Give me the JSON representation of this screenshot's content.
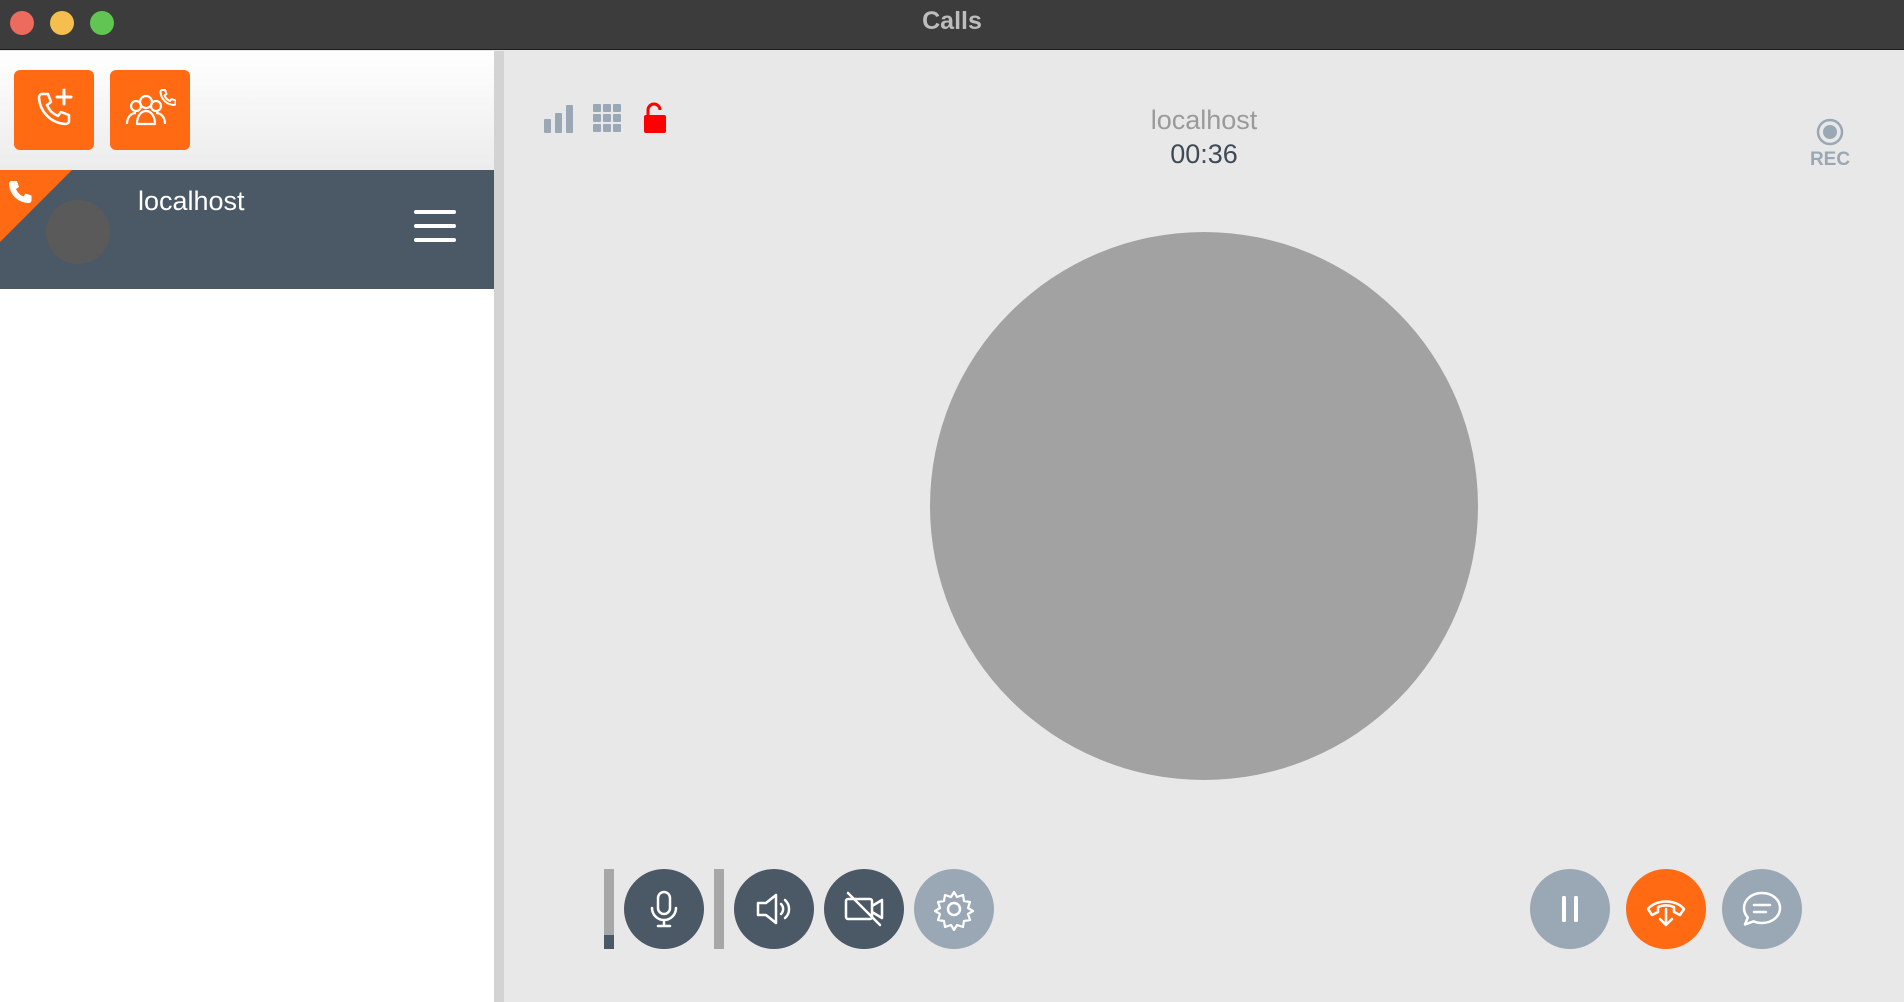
{
  "window": {
    "title": "Calls"
  },
  "sidebar": {
    "actions": [
      {
        "icon": "phone-plus-icon",
        "label": "New call"
      },
      {
        "icon": "conference-call-icon",
        "label": "Conference call"
      }
    ],
    "calls": [
      {
        "name": "localhost",
        "status_icon": "phone-icon"
      }
    ]
  },
  "call": {
    "peer": "localhost",
    "duration": "00:36",
    "record_label": "REC",
    "status_icons": [
      "signal-quality-icon",
      "dialpad-icon",
      "unlocked-icon"
    ],
    "mic_level": 0.17,
    "controls_left": [
      "microphone",
      "speaker",
      "video-off",
      "settings"
    ],
    "controls_right": [
      "hold",
      "transfer",
      "chat"
    ]
  },
  "colors": {
    "accent": "#ff6a13",
    "dark_control": "#4b5865",
    "light_control": "#9aa7b4",
    "avatar": "#a2a2a2",
    "unlocked": "#ff0000"
  }
}
